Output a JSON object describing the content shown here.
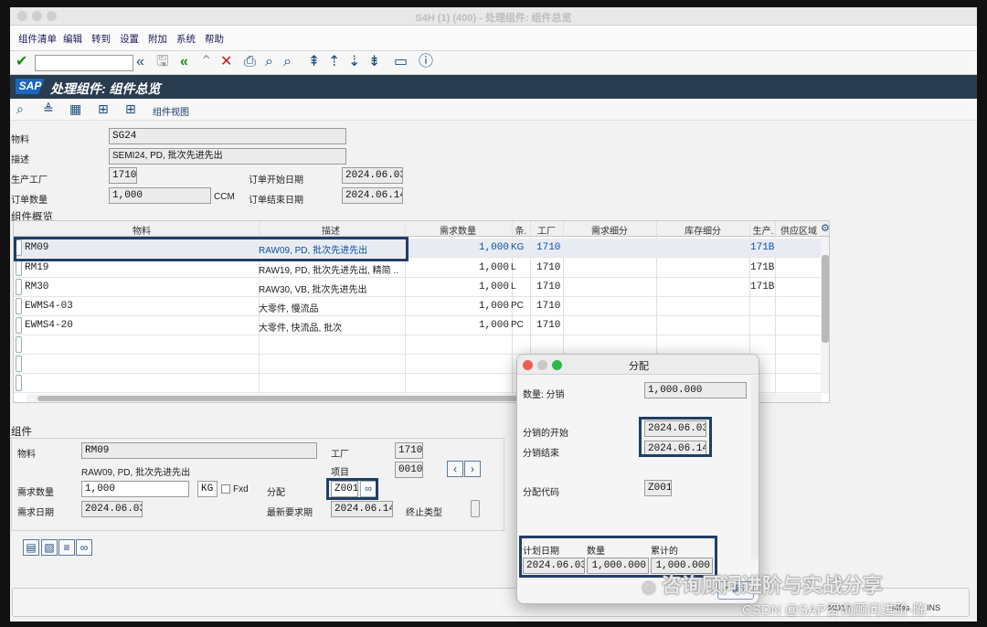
{
  "window": {
    "title": "S4H (1) (400) - 处理组件: 组件总览"
  },
  "menu": [
    "组件清单",
    "编辑",
    "转到",
    "设置",
    "附加",
    "系统",
    "帮助"
  ],
  "app": {
    "title": "处理组件: 组件总览",
    "logo": "SAP"
  },
  "app_toolbar": {
    "component_view_label": "组件视图"
  },
  "header": {
    "material_label": "物料",
    "material_value": "SG24",
    "desc_label": "描述",
    "desc_value": "SEMI24, PD, 批次先进先出",
    "plant_label": "生产工厂",
    "plant_value": "1710",
    "order_start_label": "订单开始日期",
    "order_start_value": "2024.06.03",
    "qty_label": "订单数量",
    "qty_value": "1,000",
    "qty_unit": "CCM",
    "order_end_label": "订单结束日期",
    "order_end_value": "2024.06.14"
  },
  "overview": {
    "section_title": "组件概览",
    "columns": [
      "物料",
      "描述",
      "需求数量",
      "条.",
      "工厂",
      "需求细分",
      "库存细分",
      "生产.",
      "供应区域"
    ],
    "rows": [
      {
        "material": "RM09",
        "desc": "RAW09, PD, 批次先进先出",
        "qty": "1,000",
        "unit": "KG",
        "plant": "1710",
        "prod": "171B",
        "selected": true
      },
      {
        "material": "RM19",
        "desc": "RAW19, PD, 批次先进先出, 精简 ..",
        "qty": "1,000",
        "unit": "L",
        "plant": "1710",
        "prod": "171B",
        "selected": false
      },
      {
        "material": "RM30",
        "desc": "RAW30, VB, 批次先进先出",
        "qty": "1,000",
        "unit": "L",
        "plant": "1710",
        "prod": "171B",
        "selected": false
      },
      {
        "material": "EWMS4-03",
        "desc": "大零件, 慢流品",
        "qty": "1,000",
        "unit": "PC",
        "plant": "1710",
        "prod": "",
        "selected": false
      },
      {
        "material": "EWMS4-20",
        "desc": "大零件, 快流品, 批次",
        "qty": "1,000",
        "unit": "PC",
        "plant": "1710",
        "prod": "",
        "selected": false
      }
    ]
  },
  "component": {
    "section_title": "组件",
    "material_label": "物料",
    "material_value": "RM09",
    "plant_label": "工厂",
    "plant_value": "1710",
    "desc_value": "RAW09, PD, 批次先进先出",
    "item_label": "项目",
    "item_value": "0010",
    "req_qty_label": "需求数量",
    "req_qty_value": "1,000",
    "req_unit": "KG",
    "fxd_label": "Fxd",
    "dist_label": "分配",
    "dist_value": "Z001",
    "req_date_label": "需求日期",
    "req_date_value": "2024.06.03",
    "latest_req_label": "最新要求期",
    "latest_req_value": "2024.06.14",
    "end_type_label": "终止类型"
  },
  "dialog": {
    "title": "分配",
    "qty_label": "数量: 分销",
    "qty_value": "1,000.000",
    "dist_start_label": "分销的开始",
    "dist_start_value": "2024.06.03",
    "dist_end_label": "分销结束",
    "dist_end_value": "2024.06.14",
    "dist_code_label": "分配代码",
    "dist_code_value": "Z001",
    "col_plan_date": "计划日期",
    "col_qty": "数量",
    "col_cum": "累计的",
    "row_plan_date": "2024.06.03",
    "row_qty": "1,000.000",
    "row_cum": "1,000.000",
    "ok_label": "确认"
  },
  "status": {
    "transaction": "MD13",
    "server": "s4fas",
    "mode": "INS"
  },
  "watermark": {
    "main": "咨询顾问进阶与实战分享",
    "sub": "CSDN @SAP咨询顾问进阶-陈"
  },
  "colors": {
    "accent": "#1f3f66",
    "title_bar": "#2a3c4f",
    "link_blue": "#0b4ea2",
    "check_green": "#1a8a1a",
    "cancel_red": "#c8181e"
  }
}
